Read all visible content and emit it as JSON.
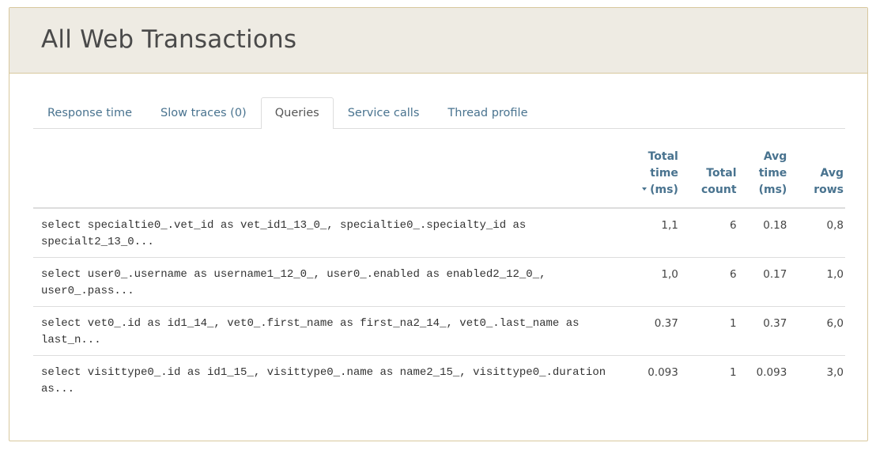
{
  "page": {
    "title": "All Web Transactions"
  },
  "tabs": [
    {
      "label": "Response time",
      "active": false
    },
    {
      "label": "Slow traces (0)",
      "active": false
    },
    {
      "label": "Queries",
      "active": true
    },
    {
      "label": "Service calls",
      "active": false
    },
    {
      "label": "Thread profile",
      "active": false
    }
  ],
  "table": {
    "headers": {
      "total_time": [
        "Total",
        "time",
        "(ms)"
      ],
      "total_count": [
        "Total",
        "count"
      ],
      "avg_time": [
        "Avg",
        "time",
        "(ms)"
      ],
      "avg_rows": [
        "Avg",
        "rows"
      ]
    },
    "sort_icon": "caret-down-icon",
    "rows": [
      {
        "query": "select specialtie0_.vet_id as vet_id1_13_0_, specialtie0_.specialty_id as specialt2_13_0...",
        "total_time": "1,1",
        "total_count": "6",
        "avg_time": "0.18",
        "avg_rows": "0,8"
      },
      {
        "query": "select user0_.username as username1_12_0_, user0_.enabled as enabled2_12_0_, user0_.pass...",
        "total_time": "1,0",
        "total_count": "6",
        "avg_time": "0.17",
        "avg_rows": "1,0"
      },
      {
        "query": "select vet0_.id as id1_14_, vet0_.first_name as first_na2_14_, vet0_.last_name as last_n...",
        "total_time": "0.37",
        "total_count": "1",
        "avg_time": "0.37",
        "avg_rows": "6,0"
      },
      {
        "query": "select visittype0_.id as id1_15_, visittype0_.name as name2_15_, visittype0_.duration as...",
        "total_time": "0.093",
        "total_count": "1",
        "avg_time": "0.093",
        "avg_rows": "3,0"
      }
    ]
  },
  "colors": {
    "accent": "#49738f",
    "header_bg": "#eeebe3",
    "panel_border": "#d8c89e"
  }
}
